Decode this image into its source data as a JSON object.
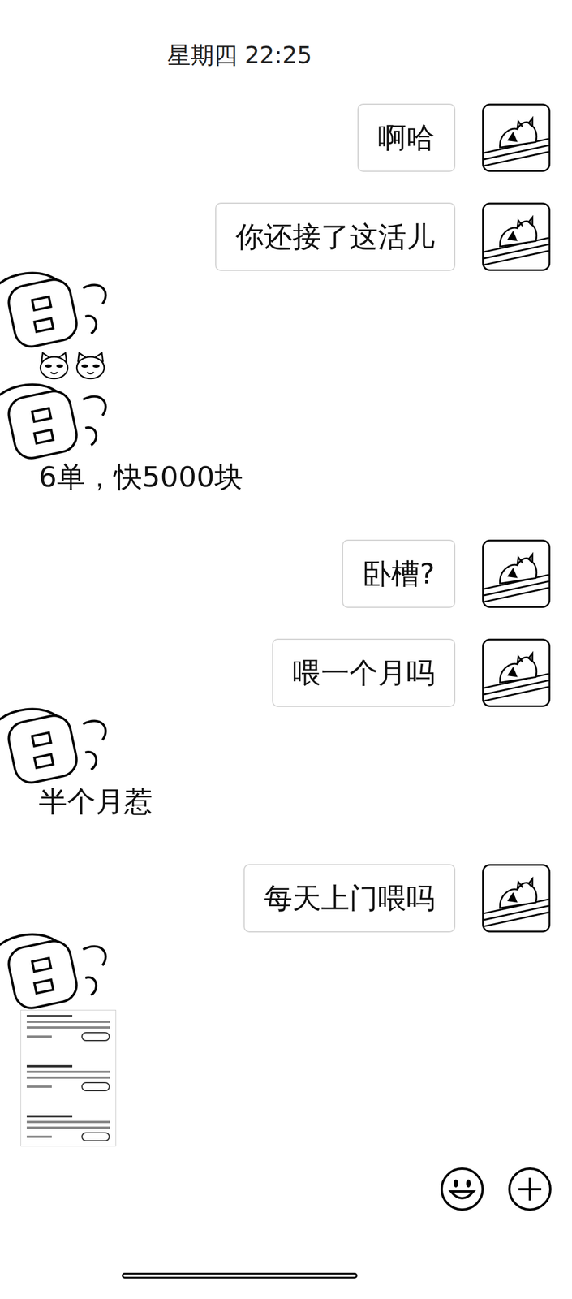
{
  "timestamp": "星期四 22:25",
  "messages": [
    {
      "side": "right",
      "kind": "text",
      "text": "啊哈"
    },
    {
      "side": "right",
      "kind": "text",
      "text": "你还接了这活儿"
    },
    {
      "side": "left",
      "kind": "sticker"
    },
    {
      "side": "left",
      "kind": "text",
      "text": "6单，快5000块"
    },
    {
      "side": "right",
      "kind": "text",
      "text": "卧槽?"
    },
    {
      "side": "right",
      "kind": "text",
      "text": "喂一个月吗"
    },
    {
      "side": "left",
      "kind": "text",
      "text": "半个月惹"
    },
    {
      "side": "right",
      "kind": "text",
      "text": "每天上门喂吗"
    },
    {
      "side": "left",
      "kind": "image"
    }
  ]
}
